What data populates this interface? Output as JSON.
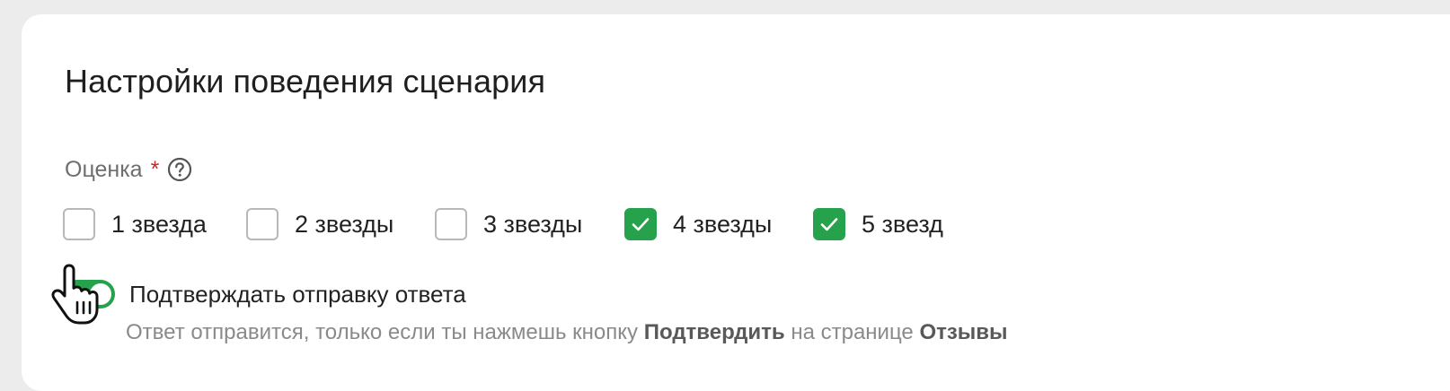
{
  "section": {
    "title": "Настройки поведения сценария"
  },
  "rating_field": {
    "label": "Оценка",
    "required_mark": "*",
    "help_icon": "question-circle-icon",
    "options": [
      {
        "label": "1 звезда",
        "checked": false
      },
      {
        "label": "2 звезды",
        "checked": false
      },
      {
        "label": "3 звезды",
        "checked": false
      },
      {
        "label": "4 звезды",
        "checked": true
      },
      {
        "label": "5 звезд",
        "checked": true
      }
    ]
  },
  "confirm_toggle": {
    "label": "Подтверждать отправку ответа",
    "on": true,
    "hint_prefix": "Ответ отправится, только если ты нажмешь кнопку",
    "hint_button": "Подтвердить",
    "hint_middle": "на странице",
    "hint_page": "Отзывы"
  },
  "colors": {
    "accent": "#27a24c",
    "required": "#c62828",
    "background": "#ececec",
    "card": "#ffffff"
  },
  "cursor_icon": "hand-pointer-icon"
}
